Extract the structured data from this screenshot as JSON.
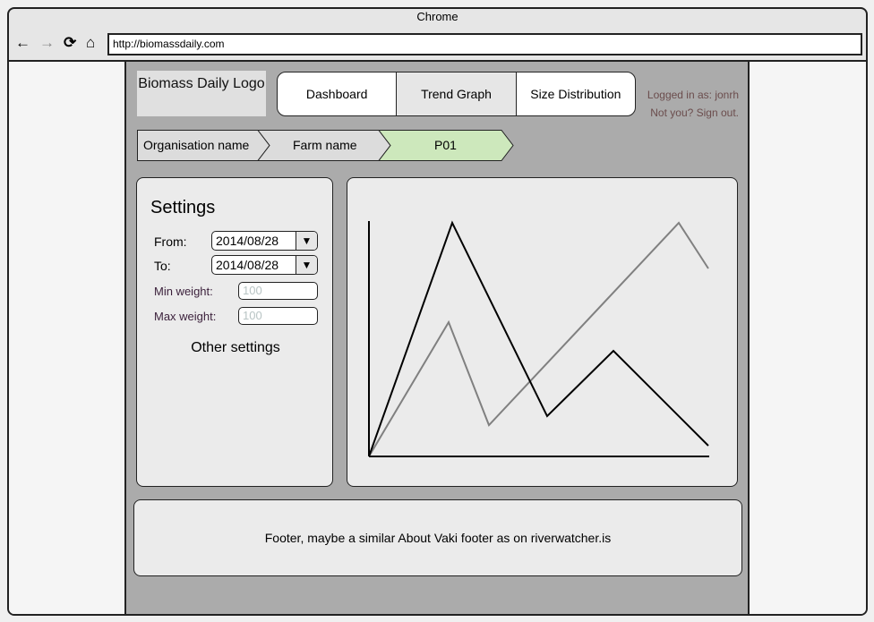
{
  "browser": {
    "title": "Chrome",
    "url": "http://biomassdaily.com",
    "icons": [
      "back-arrow-icon",
      "forward-arrow-icon",
      "reload-icon",
      "home-icon"
    ]
  },
  "header": {
    "logo": "Biomass Daily Logo",
    "tabs": [
      {
        "label": "Dashboard"
      },
      {
        "label": "Trend Graph",
        "selected": true
      },
      {
        "label": "Size Distribution"
      }
    ],
    "logged_in": "Logged in as: jonrh",
    "sign_out": "Not you? Sign out."
  },
  "breadcrumb": {
    "items": [
      "Organisation name",
      "Farm name",
      "P01"
    ],
    "active_color": "#cde8bc"
  },
  "settings": {
    "title": "Settings",
    "from_label": "From:",
    "from_value": "2014/08/28",
    "to_label": "To:",
    "to_value": "2014/08/28",
    "min_label": "Min weight:",
    "min_placeholder": "100",
    "max_label": "Max weight:",
    "max_placeholder": "100",
    "other": "Other settings"
  },
  "footer": {
    "text": "Footer, maybe a similar About Vaki footer as on riverwatcher.is"
  },
  "colors": {
    "page_bg": "#ababab",
    "panel_bg": "#ebebeb"
  }
}
